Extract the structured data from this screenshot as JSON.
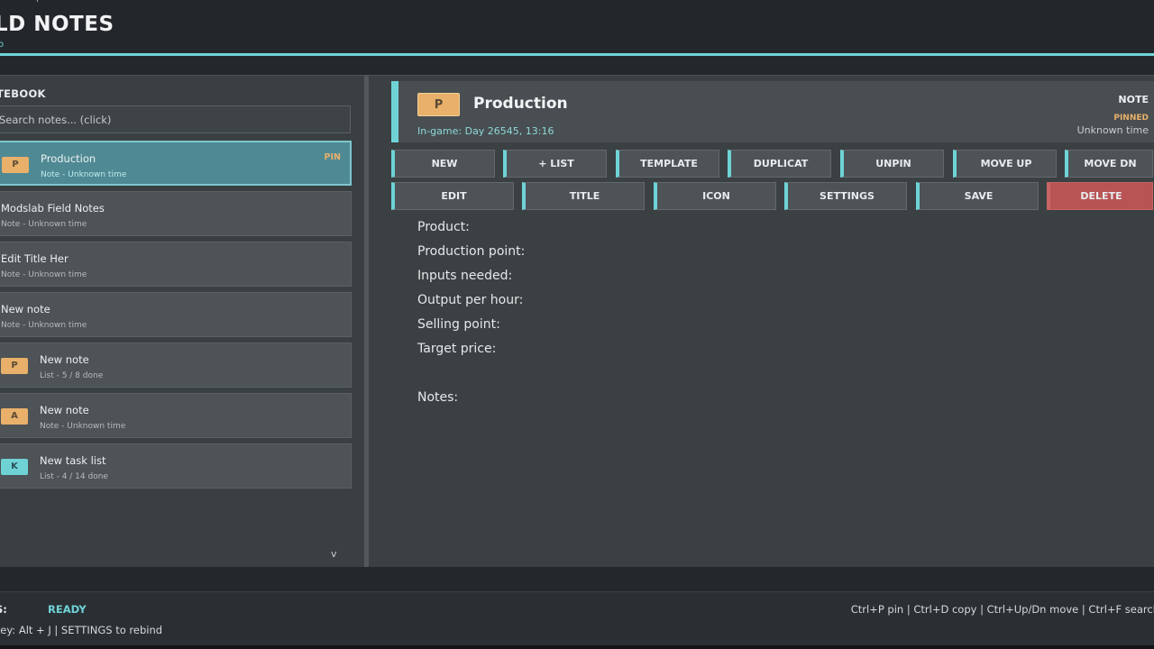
{
  "app": {
    "title": "LD NOTES",
    "top_fragment": "p",
    "sub_fragment": "o",
    "right_fragment": "I"
  },
  "sidebar": {
    "heading": "TEBOOK",
    "search_placeholder": "Search notes... (click)",
    "notes": [
      {
        "title": "Production",
        "subtitle": "Note - Unknown time",
        "icon": "P",
        "icon_color": "orange",
        "pin": "PIN",
        "active": true
      },
      {
        "title": "Modslab Field Notes",
        "subtitle": "Note - Unknown time",
        "icon": "",
        "active": false
      },
      {
        "title": "Edit Title Her",
        "subtitle": "Note - Unknown time",
        "icon": "",
        "active": false
      },
      {
        "title": "New note",
        "subtitle": "Note - Unknown time",
        "icon": "",
        "active": false
      },
      {
        "title": "New note",
        "subtitle": "List - 5 / 8 done",
        "icon": "P",
        "icon_color": "orange",
        "active": false
      },
      {
        "title": "New note",
        "subtitle": "Note - Unknown time",
        "icon": "A",
        "icon_color": "orange",
        "active": false
      },
      {
        "title": "New task list",
        "subtitle": "List - 4 / 14 done",
        "icon": "K",
        "icon_color": "teal",
        "active": false
      }
    ],
    "scroll_indicator": "v"
  },
  "editor": {
    "icon": "P",
    "title": "Production",
    "meta": "In-game: Day 26545, 13:16",
    "type": "NOTE",
    "pinned": "PINNED",
    "time": "Unknown time",
    "toolbar_row1": [
      "NEW",
      "+ LIST",
      "TEMPLATE",
      "DUPLICAT",
      "UNPIN",
      "MOVE UP",
      "MOVE DN"
    ],
    "toolbar_row2": [
      "EDIT",
      "TITLE",
      "ICON",
      "SETTINGS",
      "SAVE",
      "DELETE"
    ],
    "body_lines": [
      "Product:",
      "Production point:",
      "Inputs needed:",
      "Output per hour:",
      "Selling point:",
      "Target price:"
    ],
    "notes_label": "Notes:"
  },
  "footer": {
    "status_label": "S:",
    "status_value": "READY",
    "hotkey": "key: Alt + J  |  SETTINGS to rebind",
    "shortcuts": "Ctrl+P pin | Ctrl+D copy | Ctrl+Up/Dn move | Ctrl+F search"
  },
  "colors": {
    "accent": "#6fd3d6",
    "pin": "#e8b06a",
    "danger": "#b85454"
  }
}
